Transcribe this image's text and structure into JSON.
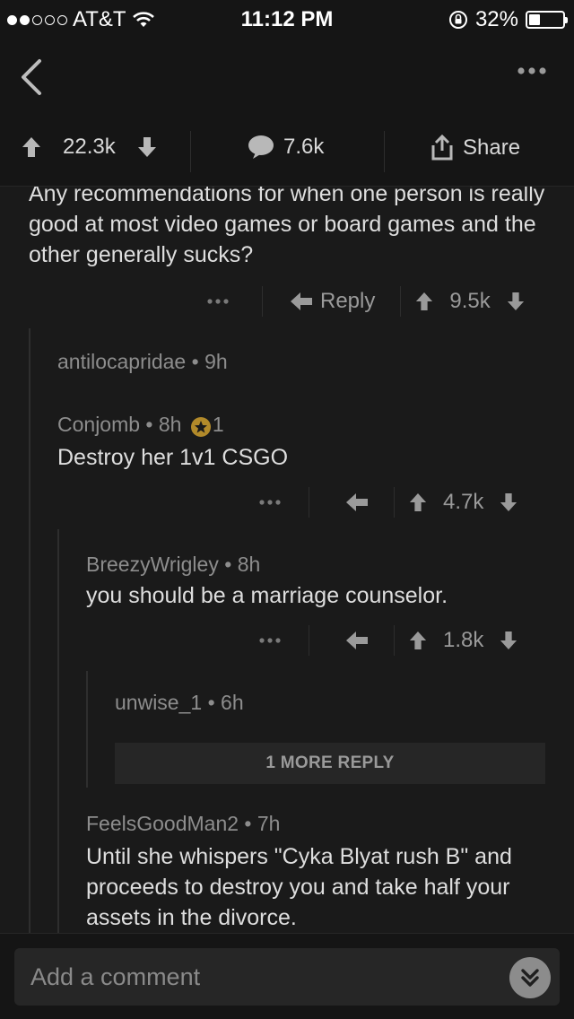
{
  "status_bar": {
    "carrier": "AT&T",
    "signal_bars_filled": 2,
    "signal_bars_total": 5,
    "time": "11:12 PM",
    "battery": "32%",
    "battery_level": 0.32
  },
  "action_bar": {
    "upvotes": "22.3k",
    "comments": "7.6k",
    "share_label": "Share"
  },
  "post": {
    "text": "Any recommendations for when one person is really good at most video games or board games and the other generally sucks?",
    "reply_label": "Reply",
    "score": "9.5k"
  },
  "comments": [
    {
      "author": "antilocapridae",
      "age": "9h"
    },
    {
      "author": "Conjomb",
      "age": "8h",
      "gold_count": "1",
      "text": "Destroy her 1v1 CSGO",
      "score": "4.7k"
    },
    {
      "author": "BreezyWrigley",
      "age": "8h",
      "text": "you should be a marriage counselor.",
      "score": "1.8k"
    },
    {
      "author": "unwise_1",
      "age": "6h"
    },
    {
      "author": "FeelsGoodMan2",
      "age": "7h",
      "text": "Until she whispers \"Cyka Blyat rush B\" and proceeds to destroy you and take half your assets in the divorce."
    }
  ],
  "more_replies_label": "1 MORE REPLY",
  "bottom": {
    "comment_placeholder": "Add a comment"
  },
  "colors": {
    "background": "#1a1a1a",
    "bar": "#151515",
    "text": "#dedede",
    "muted": "#8d8d8d",
    "gold": "#b28a2a"
  }
}
